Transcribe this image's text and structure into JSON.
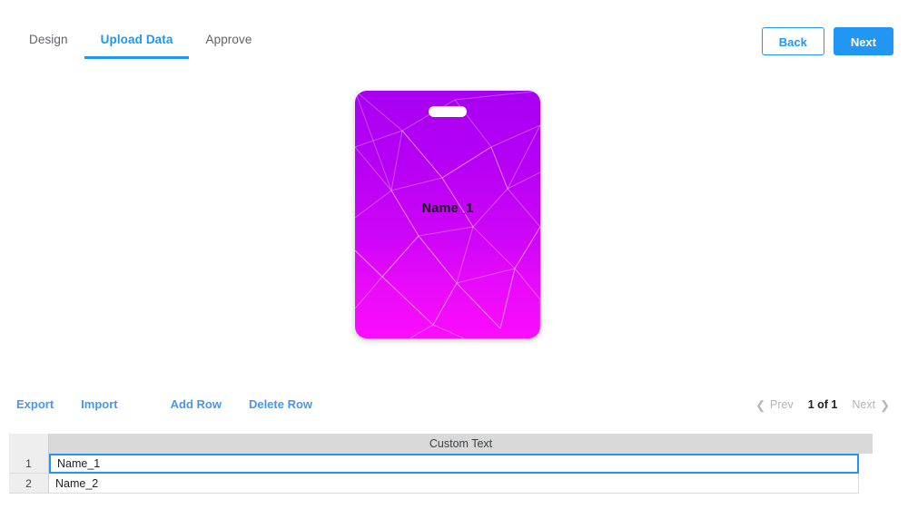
{
  "header": {
    "tabs": [
      {
        "label": "Design",
        "active": false
      },
      {
        "label": "Upload Data",
        "active": true
      },
      {
        "label": "Approve",
        "active": false
      }
    ],
    "back_label": "Back",
    "next_label": "Next"
  },
  "preview": {
    "badge_text": "Name_1",
    "gradient_top": "#A800F2",
    "gradient_bottom": "#FA0DFC",
    "slot_color": "#FFFFFF",
    "text_color": "#121212"
  },
  "toolbar": {
    "export_label": "Export",
    "import_label": "Import",
    "add_row_label": "Add Row",
    "delete_row_label": "Delete Row",
    "link_color": "#4896F0"
  },
  "pagination": {
    "prev_label": "Prev",
    "next_label": "Next",
    "page_text": "1 of 1",
    "prev_icon": "chevron-left-icon",
    "next_icon": "chevron-right-icon",
    "prev_disabled": true,
    "next_disabled": true
  },
  "grid": {
    "index_header": "",
    "columns": [
      "Custom Text"
    ],
    "rows": [
      {
        "index": "1",
        "values": [
          "Name_1"
        ],
        "selected": true
      },
      {
        "index": "2",
        "values": [
          "Name_2"
        ],
        "selected": false
      }
    ]
  },
  "colors": {
    "accent": "#2196F3",
    "header_grey": "#D9D9D9",
    "index_grey": "#EEEEEE",
    "inactive_tab": "#5F6368"
  }
}
